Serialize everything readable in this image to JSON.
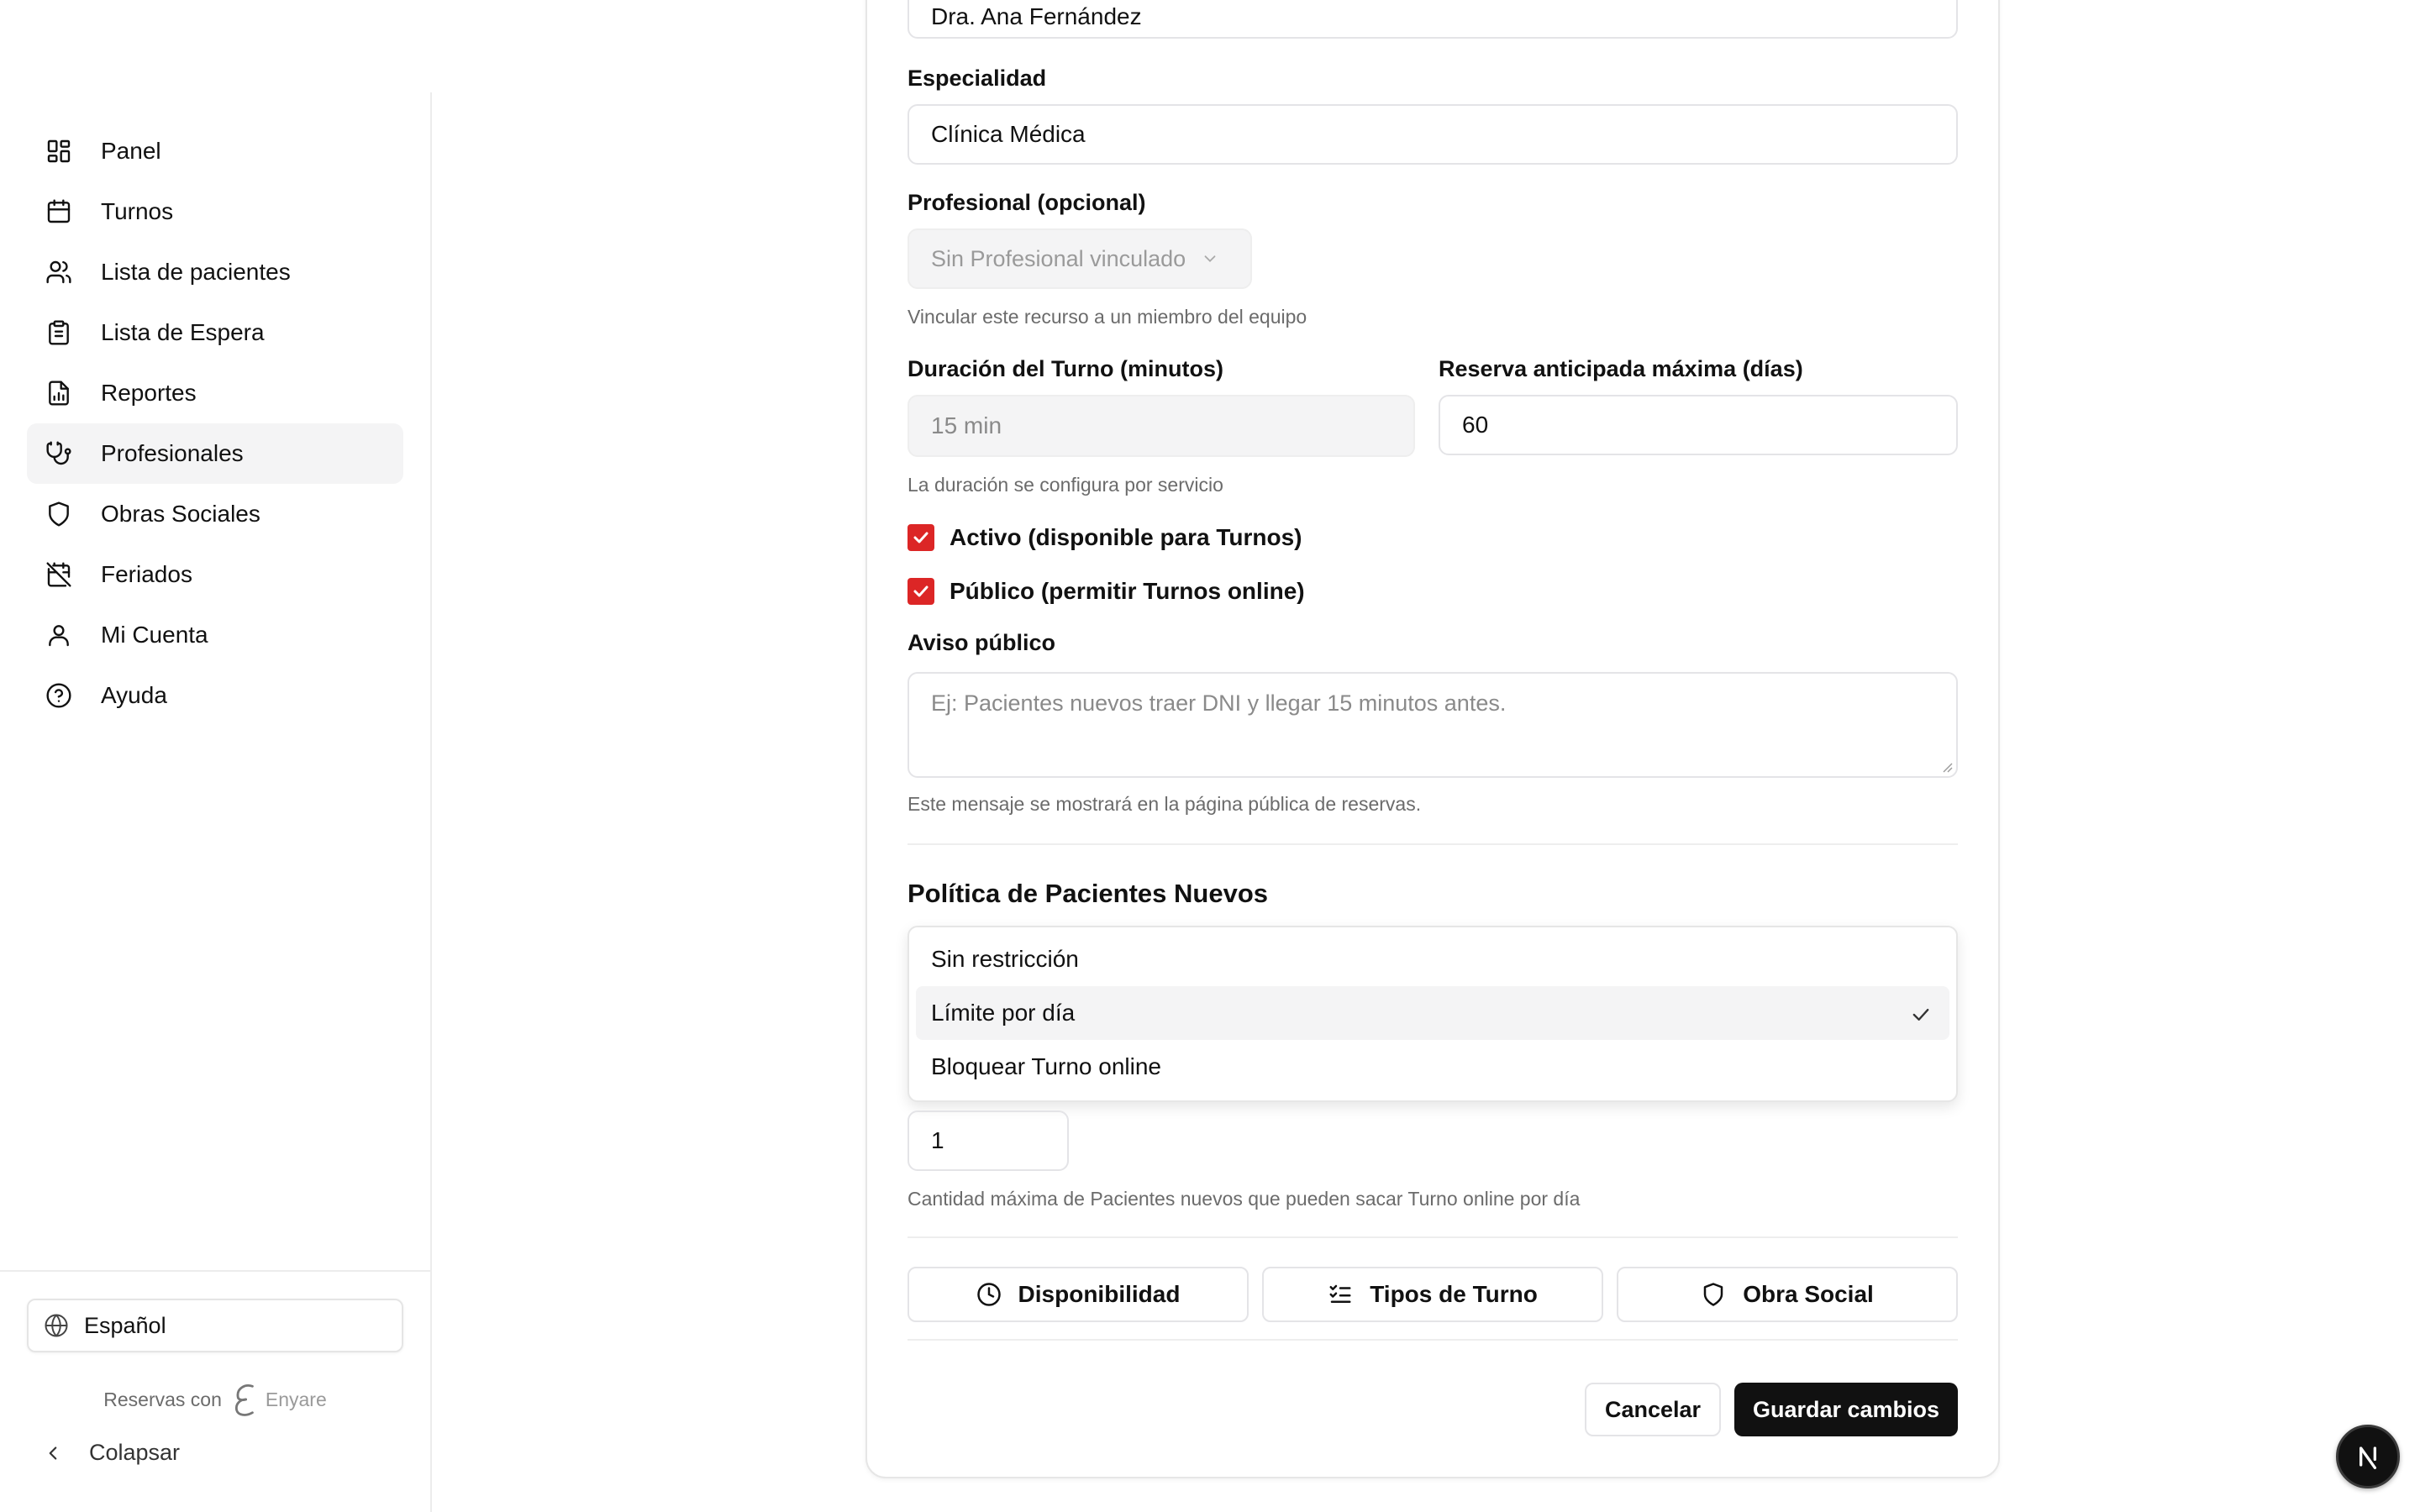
{
  "sidebar": {
    "items": [
      {
        "label": "Panel",
        "icon": "dashboard-icon"
      },
      {
        "label": "Turnos",
        "icon": "calendar-icon"
      },
      {
        "label": "Lista de pacientes",
        "icon": "users-icon"
      },
      {
        "label": "Lista de Espera",
        "icon": "clipboard-icon"
      },
      {
        "label": "Reportes",
        "icon": "report-icon"
      },
      {
        "label": "Profesionales",
        "icon": "stethoscope-icon",
        "active": true
      },
      {
        "label": "Obras Sociales",
        "icon": "shield-icon"
      },
      {
        "label": "Feriados",
        "icon": "calendar-off-icon"
      },
      {
        "label": "Mi Cuenta",
        "icon": "user-icon"
      },
      {
        "label": "Ayuda",
        "icon": "help-circle-icon"
      }
    ],
    "language": "Español",
    "powered_by": "Reservas con",
    "brand": "Enyare",
    "collapse_label": "Colapsar"
  },
  "form": {
    "name_value": "Dra. Ana Fernández",
    "specialty_label": "Especialidad",
    "specialty_value": "Clínica Médica",
    "professional_label": "Profesional (opcional)",
    "professional_value": "Sin Profesional vinculado",
    "professional_hint": "Vincular este recurso a un miembro del equipo",
    "duration_label": "Duración del Turno (minutos)",
    "duration_value": "15 min",
    "duration_hint": "La duración se configura por servicio",
    "advance_label": "Reserva anticipada máxima (días)",
    "advance_value": "60",
    "active_label": "Activo (disponible para Turnos)",
    "active_checked": true,
    "public_label": "Público (permitir Turnos online)",
    "public_checked": true,
    "notice_label": "Aviso público",
    "notice_placeholder": "Ej: Pacientes nuevos traer DNI y llegar 15 minutos antes.",
    "notice_hint": "Este mensaje se mostrará en la página pública de reservas."
  },
  "policy": {
    "title": "Política de Pacientes Nuevos",
    "options": [
      "Sin restricción",
      "Límite por día",
      "Bloquear Turno online"
    ],
    "selected": "Límite por día",
    "limit_value": "1",
    "limit_hint": "Cantidad máxima de Pacientes nuevos que pueden sacar Turno online por día"
  },
  "tabs": {
    "availability": "Disponibilidad",
    "types": "Tipos de Turno",
    "insurance": "Obra Social"
  },
  "actions": {
    "cancel": "Cancelar",
    "save": "Guardar cambios"
  },
  "colors": {
    "accent_checkbox": "#dc2626",
    "primary_button": "#111111",
    "active_nav_bg": "#f4f4f5"
  }
}
